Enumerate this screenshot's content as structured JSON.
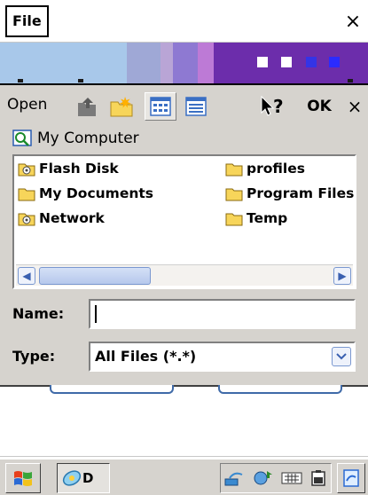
{
  "app": {
    "menu_file": "File",
    "close_glyph": "×"
  },
  "dialog": {
    "title": "Open",
    "ok_label": "OK",
    "close_glyph": "×",
    "location": "My Computer",
    "items": [
      {
        "label": "Flash Disk",
        "icon": "drive-icon"
      },
      {
        "label": "My Documents",
        "icon": "folder-icon"
      },
      {
        "label": "Network",
        "icon": "drive-icon"
      },
      {
        "label": "profiles",
        "icon": "folder-icon"
      },
      {
        "label": "Program Files",
        "icon": "folder-icon"
      },
      {
        "label": "Temp",
        "icon": "folder-icon"
      }
    ],
    "name_label": "Name:",
    "name_value": "",
    "type_label": "Type:",
    "type_value": "All Files (*.*)"
  },
  "taskbar": {
    "task_label": "D"
  },
  "colors": {
    "dialog_bg": "#d6d3ce",
    "folder_yellow": "#f7d55a",
    "accent_purple": "#6c2dab"
  }
}
